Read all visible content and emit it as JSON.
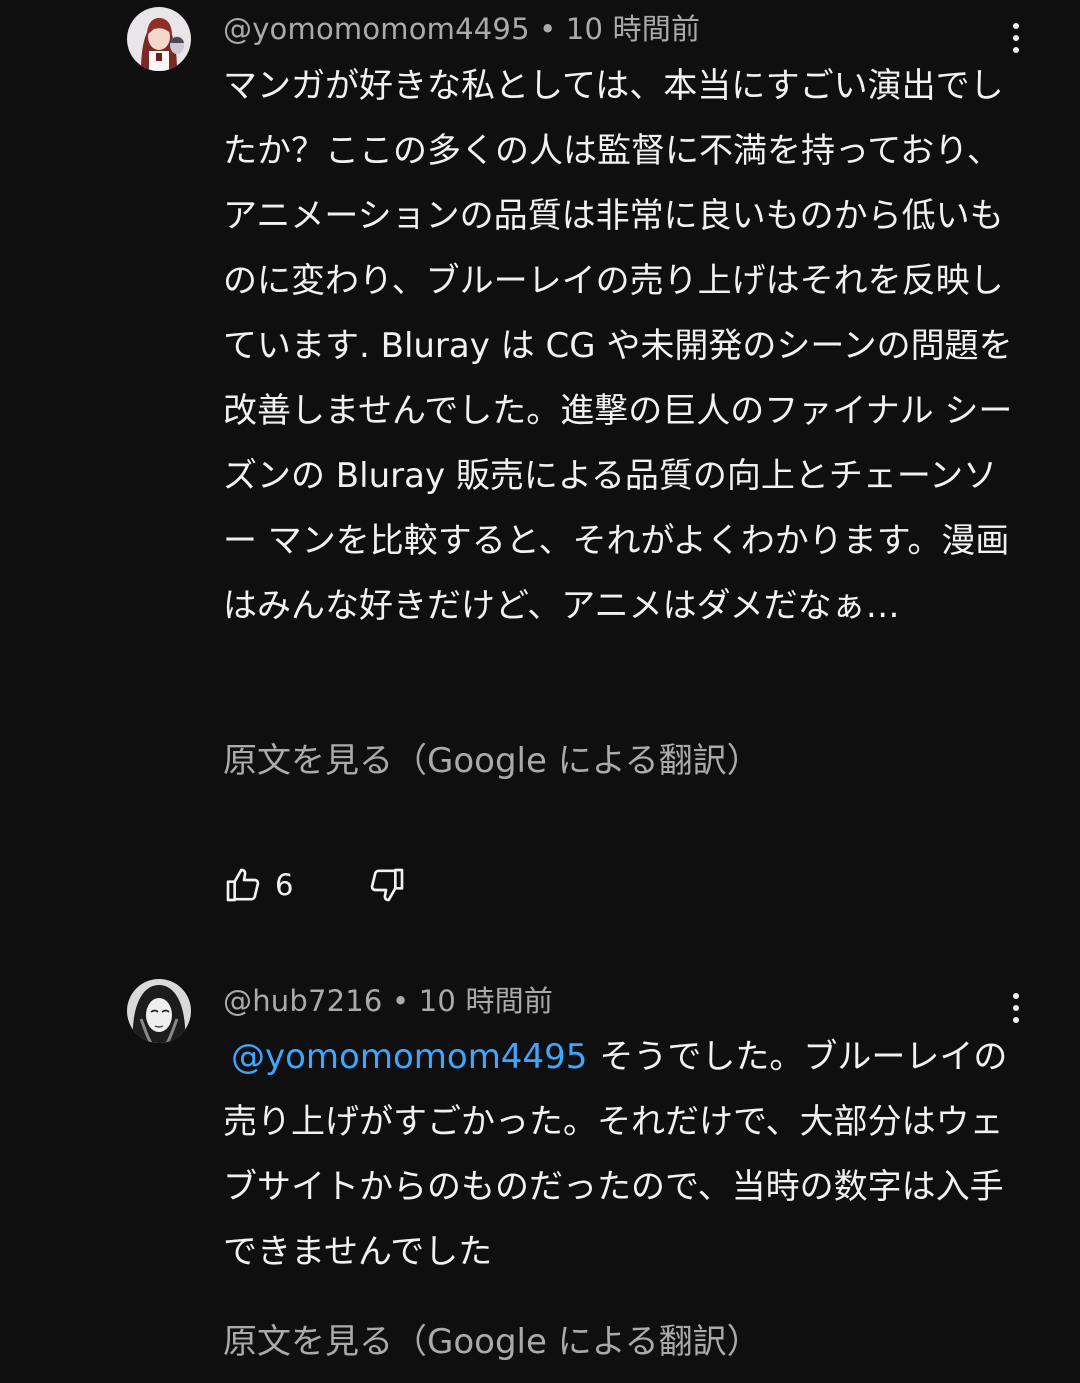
{
  "comments": [
    {
      "author": "@yomomomom4495",
      "separator": "•",
      "time": "10 時間前",
      "text": "マンガが好きな私としては、本当にすごい演出でしたか？ここの多くの人は監督に不満を持っており、アニメーションの品質は非常に良いものから低いものに変わり、ブルーレイの売り上げはそれを反映しています. Bluray は CG や未開発のシーンの問題を改善しませんでした。進撃の巨人のファイナル シーズンの Bluray 販売による品質の向上とチェーンソー マンを比較すると、それがよくわかります。漫画はみんな好きだけど、アニメはダメだなぁ…",
      "translate_label": "原文を見る（Google による翻訳）",
      "likes": "6",
      "avatar_icon": "anime-character-avatar",
      "menu_icon": "more-vert-icon"
    },
    {
      "author": "@hub7216",
      "separator": "•",
      "time": "10 時間前",
      "mention": "@yomomomom4495",
      "text": "そうでした。ブルーレイの売り上げがすごかった。それだけで、大部分はウェブサイトからのものだったので、当時の数字は入手できませんでした",
      "translate_label": "原文を見る（Google による翻訳）",
      "avatar_icon": "sketch-portrait-avatar",
      "menu_icon": "more-vert-icon"
    }
  ],
  "colors": {
    "background": "#0f0f0f",
    "text": "#f1f1f1",
    "secondary_text": "#aaaaaa",
    "mention": "#3ea6ff"
  }
}
